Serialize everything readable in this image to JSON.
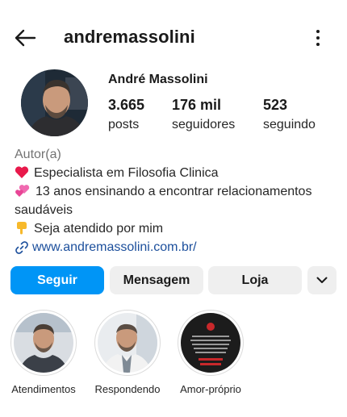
{
  "header": {
    "username": "andremassolini",
    "back_icon": "arrow-left-icon",
    "more_icon": "vertical-dots-icon"
  },
  "profile": {
    "full_name": "André Massolini",
    "stats": [
      {
        "value": "3.665",
        "label": "posts"
      },
      {
        "value": "176 mil",
        "label": "seguidores"
      },
      {
        "value": "523",
        "label": "seguindo"
      }
    ]
  },
  "bio": {
    "category": "Autor(a)",
    "line1": "Especialista em Filosofia Clinica",
    "line2a": "13 anos ensinando a encontrar relacionamentos",
    "line2b": "saudáveis",
    "line3": "Seja atendido por mim",
    "link": "www.andremassolini.com.br/"
  },
  "actions": {
    "follow": "Seguir",
    "message": "Mensagem",
    "shop": "Loja",
    "expand_icon": "chevron-down-icon"
  },
  "highlights": [
    {
      "label": "Atendimentos"
    },
    {
      "label": "Respondendo"
    },
    {
      "label": "Amor-próprio"
    }
  ],
  "colors": {
    "primary_button": "#0095f6",
    "secondary_button": "#efefef",
    "link": "#1c4f9c"
  }
}
